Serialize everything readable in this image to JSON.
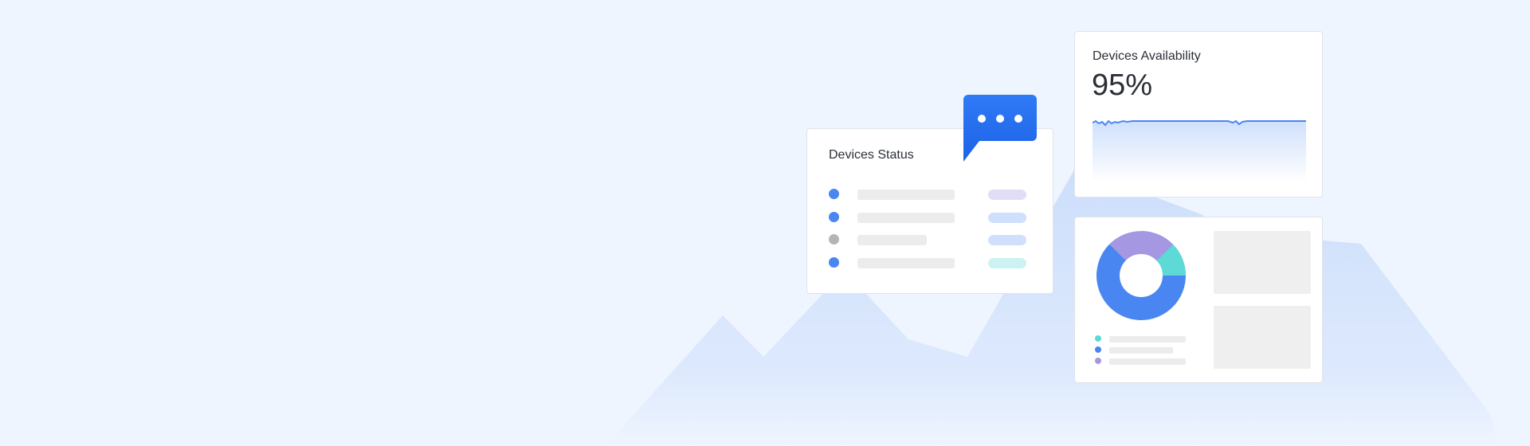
{
  "colors": {
    "background": "#eef5fe",
    "accent": "#4287f5",
    "dot_blue": "#4a86f2",
    "dot_gray": "#b5b5b5",
    "pill_purple": "#e2ddf6",
    "pill_blue": "#cfdffc",
    "pill_teal": "#ccf3f1",
    "donut_blue": "#4a86f2",
    "donut_purple": "#a597e2",
    "donut_teal": "#5dd9d6"
  },
  "status_card": {
    "title": "Devices Status"
  },
  "chat_bubble": {
    "icon": "chat-bubble-ellipsis-icon"
  },
  "availability_card": {
    "title": "Devices Availability",
    "value": "95%"
  },
  "donut_card": {
    "legend_colors": [
      "#5dd9d6",
      "#4a86f2",
      "#a597e2"
    ]
  }
}
